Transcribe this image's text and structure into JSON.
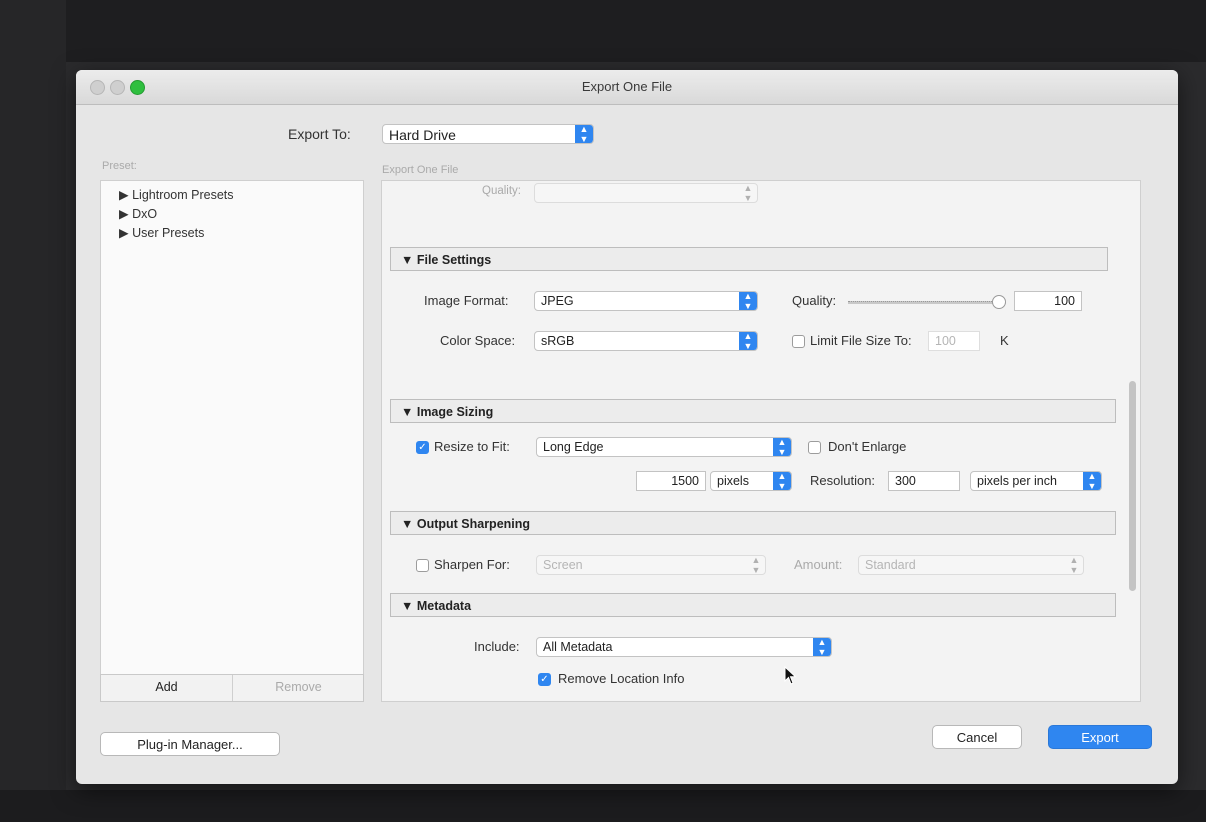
{
  "window": {
    "title": "Export One File"
  },
  "export_to": {
    "label": "Export To:",
    "value": "Hard Drive"
  },
  "preset": {
    "label": "Preset:",
    "summary_label": "Export One File",
    "items": [
      "▶ Lightroom Presets",
      "▶ DxO",
      "▶ User Presets"
    ],
    "add_label": "Add",
    "remove_label": "Remove"
  },
  "top_section": {
    "quality_label": "Quality:"
  },
  "file_settings": {
    "header": "▼ File Settings",
    "image_format_label": "Image Format:",
    "image_format_value": "JPEG",
    "quality_label": "Quality:",
    "quality_value": "100",
    "color_space_label": "Color Space:",
    "color_space_value": "sRGB",
    "limit_label": "Limit File Size To:",
    "limit_value": "100",
    "limit_unit": "K",
    "limit_checked": false
  },
  "image_sizing": {
    "header": "▼ Image Sizing",
    "resize_label": "Resize to Fit:",
    "resize_checked": true,
    "resize_value": "Long Edge",
    "dont_enlarge_label": "Don't Enlarge",
    "dont_enlarge_checked": false,
    "size_value": "1500",
    "size_unit": "pixels",
    "resolution_label": "Resolution:",
    "resolution_value": "300",
    "resolution_unit": "pixels per inch"
  },
  "output_sharpening": {
    "header": "▼ Output Sharpening",
    "sharpen_label": "Sharpen For:",
    "sharpen_checked": false,
    "sharpen_value": "Screen",
    "amount_label": "Amount:",
    "amount_value": "Standard"
  },
  "metadata": {
    "header": "▼ Metadata",
    "include_label": "Include:",
    "include_value": "All Metadata",
    "remove_location_label": "Remove Location Info",
    "remove_location_checked": true
  },
  "footer": {
    "plugin_manager_label": "Plug-in Manager...",
    "cancel_label": "Cancel",
    "export_label": "Export"
  },
  "colors": {
    "accent": "#2f86f0",
    "zoom_button": "#2fbf3f"
  }
}
